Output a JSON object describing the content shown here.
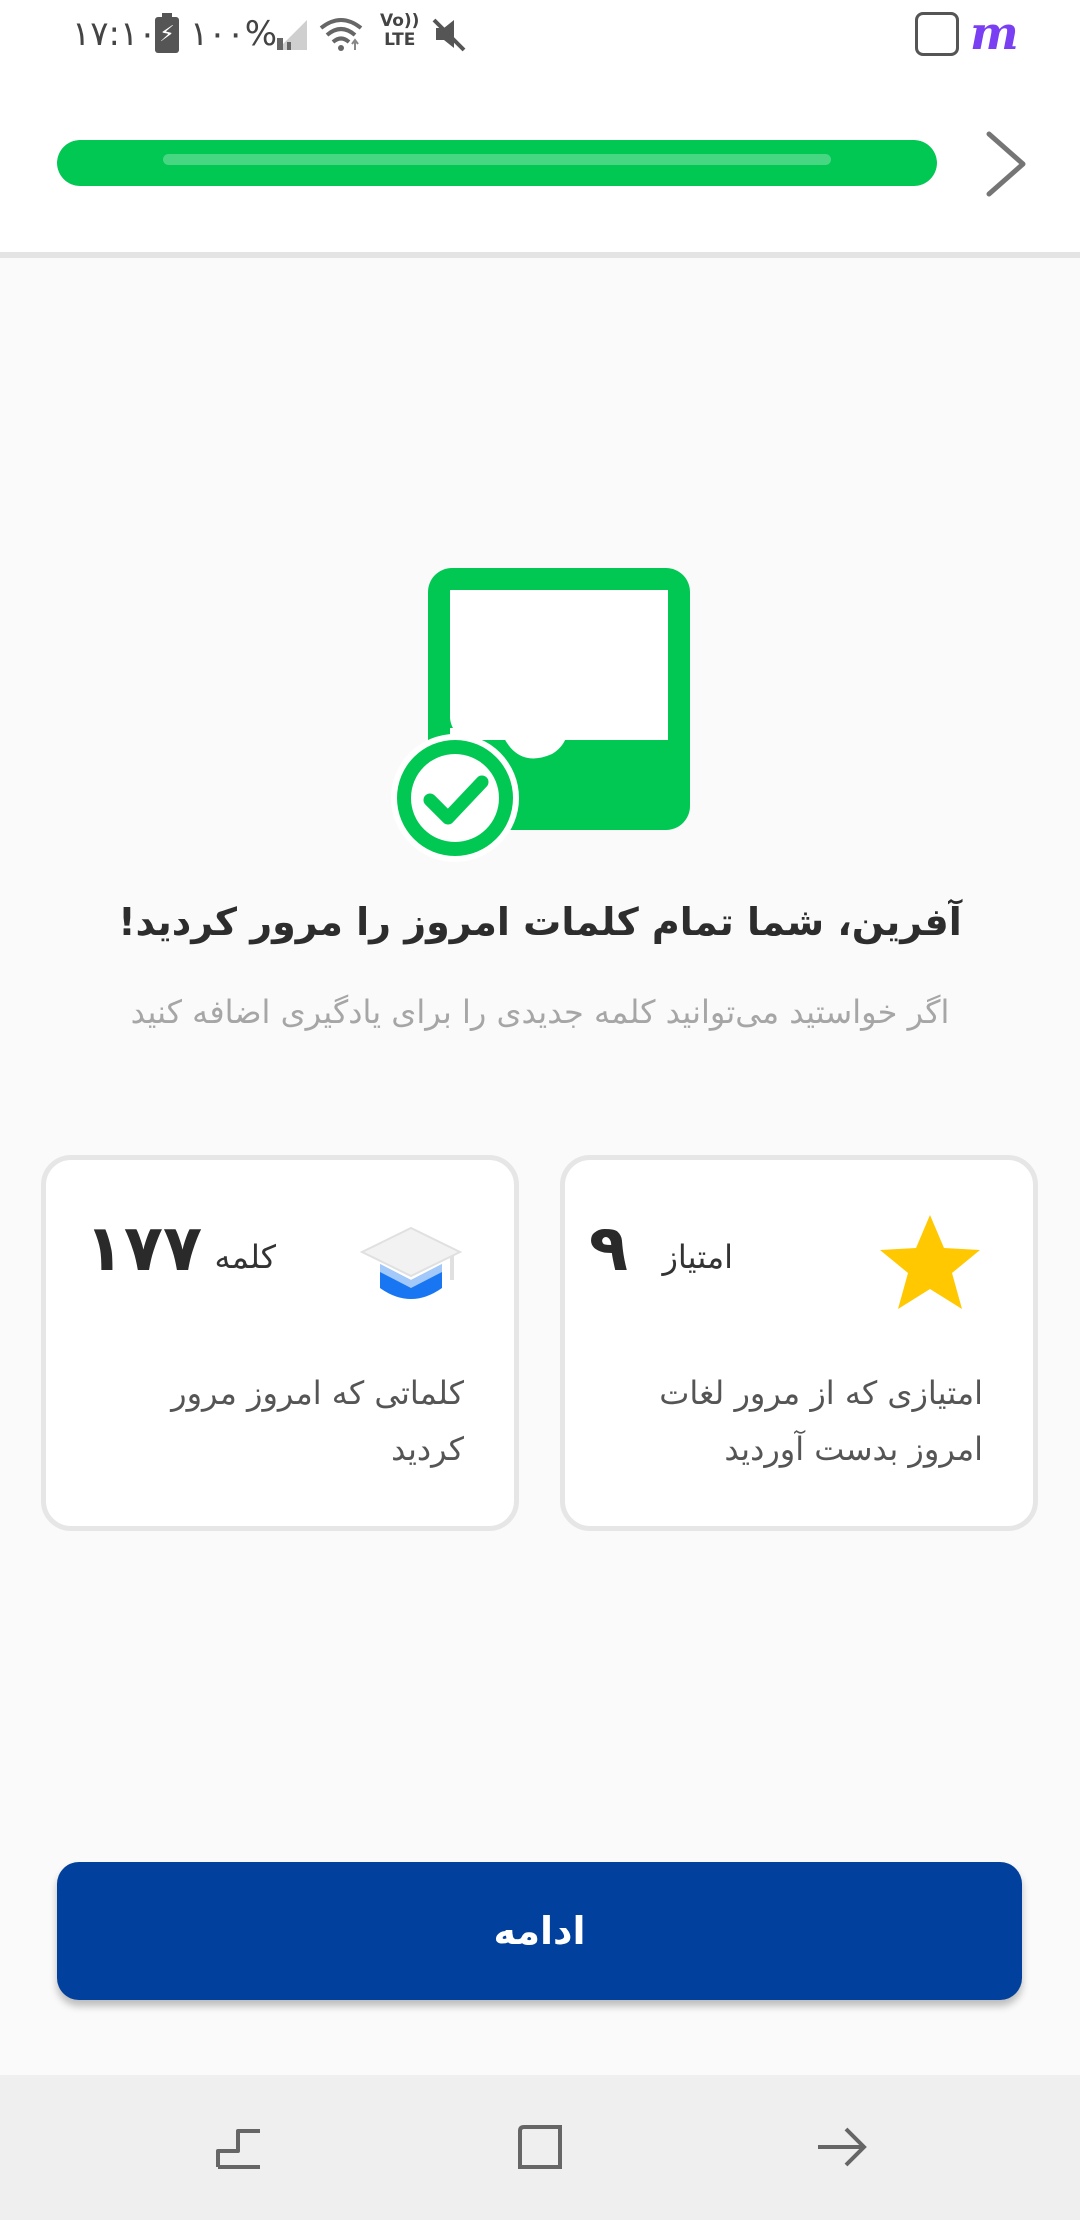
{
  "status_bar": {
    "time": "۱۷:۱۰",
    "battery": "۱۰۰%",
    "lte_top": "Vo))",
    "lte_bottom": "LTE",
    "app_badge": "m"
  },
  "progress": {
    "fraction": 1.0
  },
  "message": {
    "title": "آفرین، شما تمام کلمات امروز را مرور کردید!",
    "subtitle": "اگر خواستید می‌توانید کلمه جدیدی را برای یادگیری اضافه کنید"
  },
  "cards": {
    "score": {
      "label": "امتیاز",
      "value": "۹",
      "description": "امتیازی که از مرور لغات امروز بدست آوردید",
      "icon": "star-icon"
    },
    "words": {
      "label": "کلمه",
      "value": "۱۷۷",
      "description": "کلماتی که امروز مرور کردید",
      "icon": "graduation-cap-icon"
    }
  },
  "continue_label": "ادامه",
  "colors": {
    "accent_green": "#00c853",
    "button_blue": "#01409c",
    "star_yellow": "#ffc800",
    "cap_blue": "#1976f2"
  }
}
